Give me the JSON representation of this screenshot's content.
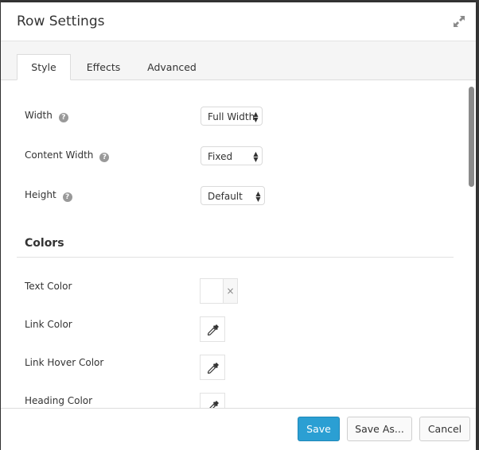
{
  "dialog": {
    "title": "Row Settings",
    "expand_icon": "expand-arrows-icon"
  },
  "tabs": [
    {
      "label": "Style",
      "active": true
    },
    {
      "label": "Effects",
      "active": false
    },
    {
      "label": "Advanced",
      "active": false
    }
  ],
  "fields": [
    {
      "label": "Width",
      "help": "?",
      "value": "Full Width"
    },
    {
      "label": "Content Width",
      "help": "?",
      "value": "Fixed"
    },
    {
      "label": "Height",
      "help": "?",
      "value": "Default"
    }
  ],
  "colors_section": {
    "title": "Colors",
    "items": [
      {
        "label": "Text Color",
        "type": "swatch",
        "clear": "×"
      },
      {
        "label": "Link Color",
        "type": "picker",
        "icon": "eyedropper-icon"
      },
      {
        "label": "Link Hover Color",
        "type": "picker",
        "icon": "eyedropper-icon"
      },
      {
        "label": "Heading Color",
        "type": "picker",
        "icon": "eyedropper-icon"
      }
    ]
  },
  "footer": {
    "save_label": "Save",
    "save_as_label": "Save As...",
    "cancel_label": "Cancel"
  },
  "colors": {
    "primary": "#2b9fd3",
    "tabbar_bg": "#f5f5f5"
  }
}
